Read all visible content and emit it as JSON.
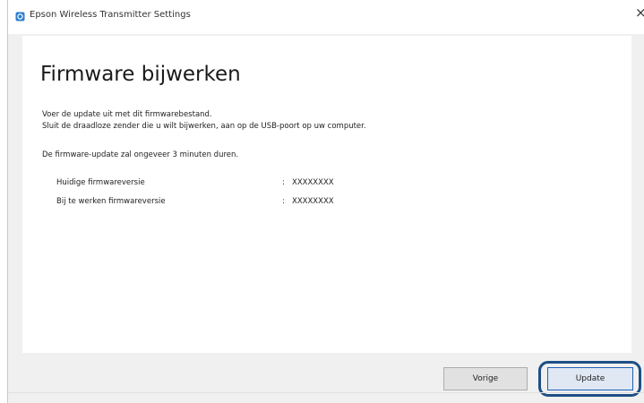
{
  "window": {
    "title": "Epson Wireless Transmitter Settings",
    "close_glyph": "×"
  },
  "page": {
    "title": "Firmware bijwerken",
    "instructions": [
      "Voer de update uit met dit firmwarebestand.",
      "Sluit de draadloze zender die u wilt bijwerken, aan op de USB-poort op uw computer."
    ],
    "duration_note": "De firmware-update zal ongeveer 3 minuten duren.",
    "versions": [
      {
        "label": "Huidige firmwareversie",
        "separator": ":",
        "value": "XXXXXXXX"
      },
      {
        "label": "Bij te werken firmwareversie",
        "separator": ":",
        "value": "XXXXXXXX"
      }
    ]
  },
  "buttons": {
    "previous_label": "Vorige",
    "update_label": "Update"
  },
  "icons": {
    "app": "epson-settings-icon",
    "close": "close-icon"
  },
  "colors": {
    "window_bg": "#f0f0f0",
    "panel_bg": "#ffffff",
    "highlight_ring": "#1d4f86",
    "accent": "#1f5fb8"
  }
}
